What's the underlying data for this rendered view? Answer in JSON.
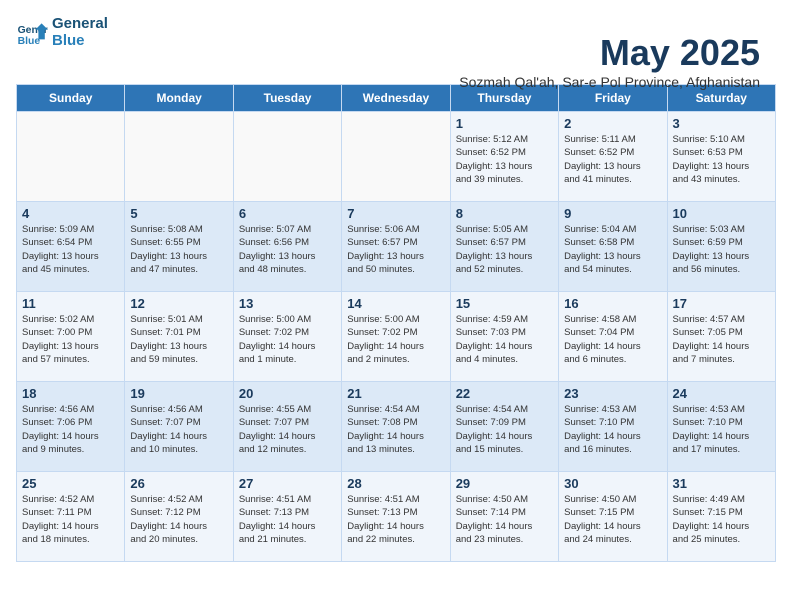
{
  "logo": {
    "line1": "General",
    "line2": "Blue"
  },
  "title": "May 2025",
  "subtitle": "Sozmah Qal'ah, Sar-e Pol Province, Afghanistan",
  "days_of_week": [
    "Sunday",
    "Monday",
    "Tuesday",
    "Wednesday",
    "Thursday",
    "Friday",
    "Saturday"
  ],
  "weeks": [
    [
      {
        "day": "",
        "info": ""
      },
      {
        "day": "",
        "info": ""
      },
      {
        "day": "",
        "info": ""
      },
      {
        "day": "",
        "info": ""
      },
      {
        "day": "1",
        "info": "Sunrise: 5:12 AM\nSunset: 6:52 PM\nDaylight: 13 hours\nand 39 minutes."
      },
      {
        "day": "2",
        "info": "Sunrise: 5:11 AM\nSunset: 6:52 PM\nDaylight: 13 hours\nand 41 minutes."
      },
      {
        "day": "3",
        "info": "Sunrise: 5:10 AM\nSunset: 6:53 PM\nDaylight: 13 hours\nand 43 minutes."
      }
    ],
    [
      {
        "day": "4",
        "info": "Sunrise: 5:09 AM\nSunset: 6:54 PM\nDaylight: 13 hours\nand 45 minutes."
      },
      {
        "day": "5",
        "info": "Sunrise: 5:08 AM\nSunset: 6:55 PM\nDaylight: 13 hours\nand 47 minutes."
      },
      {
        "day": "6",
        "info": "Sunrise: 5:07 AM\nSunset: 6:56 PM\nDaylight: 13 hours\nand 48 minutes."
      },
      {
        "day": "7",
        "info": "Sunrise: 5:06 AM\nSunset: 6:57 PM\nDaylight: 13 hours\nand 50 minutes."
      },
      {
        "day": "8",
        "info": "Sunrise: 5:05 AM\nSunset: 6:57 PM\nDaylight: 13 hours\nand 52 minutes."
      },
      {
        "day": "9",
        "info": "Sunrise: 5:04 AM\nSunset: 6:58 PM\nDaylight: 13 hours\nand 54 minutes."
      },
      {
        "day": "10",
        "info": "Sunrise: 5:03 AM\nSunset: 6:59 PM\nDaylight: 13 hours\nand 56 minutes."
      }
    ],
    [
      {
        "day": "11",
        "info": "Sunrise: 5:02 AM\nSunset: 7:00 PM\nDaylight: 13 hours\nand 57 minutes."
      },
      {
        "day": "12",
        "info": "Sunrise: 5:01 AM\nSunset: 7:01 PM\nDaylight: 13 hours\nand 59 minutes."
      },
      {
        "day": "13",
        "info": "Sunrise: 5:00 AM\nSunset: 7:02 PM\nDaylight: 14 hours\nand 1 minute."
      },
      {
        "day": "14",
        "info": "Sunrise: 5:00 AM\nSunset: 7:02 PM\nDaylight: 14 hours\nand 2 minutes."
      },
      {
        "day": "15",
        "info": "Sunrise: 4:59 AM\nSunset: 7:03 PM\nDaylight: 14 hours\nand 4 minutes."
      },
      {
        "day": "16",
        "info": "Sunrise: 4:58 AM\nSunset: 7:04 PM\nDaylight: 14 hours\nand 6 minutes."
      },
      {
        "day": "17",
        "info": "Sunrise: 4:57 AM\nSunset: 7:05 PM\nDaylight: 14 hours\nand 7 minutes."
      }
    ],
    [
      {
        "day": "18",
        "info": "Sunrise: 4:56 AM\nSunset: 7:06 PM\nDaylight: 14 hours\nand 9 minutes."
      },
      {
        "day": "19",
        "info": "Sunrise: 4:56 AM\nSunset: 7:07 PM\nDaylight: 14 hours\nand 10 minutes."
      },
      {
        "day": "20",
        "info": "Sunrise: 4:55 AM\nSunset: 7:07 PM\nDaylight: 14 hours\nand 12 minutes."
      },
      {
        "day": "21",
        "info": "Sunrise: 4:54 AM\nSunset: 7:08 PM\nDaylight: 14 hours\nand 13 minutes."
      },
      {
        "day": "22",
        "info": "Sunrise: 4:54 AM\nSunset: 7:09 PM\nDaylight: 14 hours\nand 15 minutes."
      },
      {
        "day": "23",
        "info": "Sunrise: 4:53 AM\nSunset: 7:10 PM\nDaylight: 14 hours\nand 16 minutes."
      },
      {
        "day": "24",
        "info": "Sunrise: 4:53 AM\nSunset: 7:10 PM\nDaylight: 14 hours\nand 17 minutes."
      }
    ],
    [
      {
        "day": "25",
        "info": "Sunrise: 4:52 AM\nSunset: 7:11 PM\nDaylight: 14 hours\nand 18 minutes."
      },
      {
        "day": "26",
        "info": "Sunrise: 4:52 AM\nSunset: 7:12 PM\nDaylight: 14 hours\nand 20 minutes."
      },
      {
        "day": "27",
        "info": "Sunrise: 4:51 AM\nSunset: 7:13 PM\nDaylight: 14 hours\nand 21 minutes."
      },
      {
        "day": "28",
        "info": "Sunrise: 4:51 AM\nSunset: 7:13 PM\nDaylight: 14 hours\nand 22 minutes."
      },
      {
        "day": "29",
        "info": "Sunrise: 4:50 AM\nSunset: 7:14 PM\nDaylight: 14 hours\nand 23 minutes."
      },
      {
        "day": "30",
        "info": "Sunrise: 4:50 AM\nSunset: 7:15 PM\nDaylight: 14 hours\nand 24 minutes."
      },
      {
        "day": "31",
        "info": "Sunrise: 4:49 AM\nSunset: 7:15 PM\nDaylight: 14 hours\nand 25 minutes."
      }
    ]
  ]
}
